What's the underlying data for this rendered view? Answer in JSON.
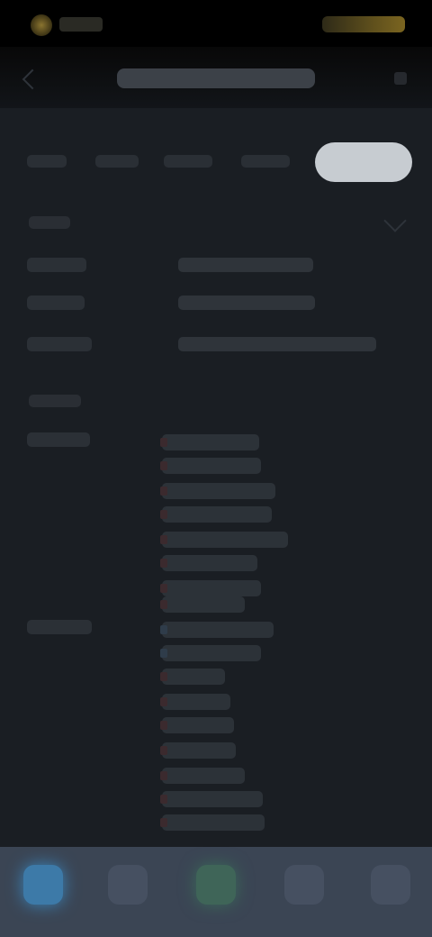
{
  "status_bar": {
    "brand_icon": "app-logo-icon",
    "right_icon": "account-badge-icon"
  },
  "header": {
    "title": "",
    "back_icon": "chevron-left-icon",
    "more_icon": "more-icon"
  },
  "tabs": [
    {
      "label": "",
      "active": false
    },
    {
      "label": "",
      "active": false
    },
    {
      "label": "",
      "active": false
    },
    {
      "label": "",
      "active": false
    },
    {
      "label": "",
      "active": true
    }
  ],
  "sections": {
    "overview_label": "",
    "collapse_icon": "chevron-down-icon",
    "second_label": ""
  },
  "fields": [
    {
      "label": "",
      "value": ""
    },
    {
      "label": "",
      "value": ""
    },
    {
      "label": "",
      "value": ""
    }
  ],
  "groups": [
    {
      "label": "",
      "items": [
        "",
        "",
        "",
        "",
        "",
        "",
        "",
        ""
      ]
    },
    {
      "label": "",
      "items": [
        "",
        "",
        "",
        "",
        "",
        "",
        "",
        "",
        ""
      ]
    }
  ],
  "bottom_nav": [
    {
      "label": "",
      "icon": "home-icon",
      "active": true
    },
    {
      "label": "",
      "icon": "list-icon",
      "active": false
    },
    {
      "label": "",
      "icon": "action-icon",
      "active": false
    },
    {
      "label": "",
      "icon": "chart-icon",
      "active": false
    },
    {
      "label": "",
      "icon": "profile-icon",
      "active": false
    }
  ],
  "colors": {
    "background": "#1a1e23",
    "active_tab": "#c7ccd1",
    "nav_bar": "#3b4554",
    "nav_active": "#3d7aa8",
    "nav_cta": "#3f6558",
    "status_accent": "#7b6520",
    "item_marker": "#3b2a2e"
  }
}
